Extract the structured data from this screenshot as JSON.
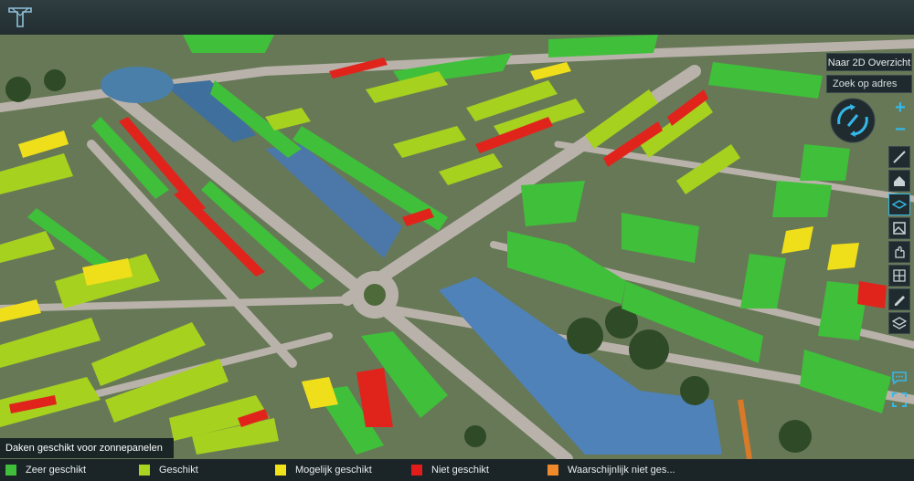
{
  "header": {
    "logo_icon": "tygron-logo-icon"
  },
  "map": {
    "icon": "3d-city-map",
    "colors": {
      "very_suitable": "#3fbf3a",
      "suitable": "#9fd321",
      "possibly": "#f0e020",
      "not": "#e02020",
      "unlikely": "#f08a20",
      "water": "#4a7fb0",
      "road": "#b8b0a8",
      "grass": "#6e8a4e"
    }
  },
  "controls": {
    "view_2d_label": "Naar 2D Overzicht",
    "search_placeholder": "Zoek op adres",
    "zoom_in": "+",
    "zoom_out": "−",
    "compass_icon": "compass-rotate-icon",
    "tools": [
      {
        "icon": "measure-icon",
        "active": false
      },
      {
        "icon": "home-icon",
        "active": false
      },
      {
        "icon": "layers-icon",
        "active": true
      },
      {
        "icon": "image-icon",
        "active": false
      },
      {
        "icon": "hand-icon",
        "active": false
      },
      {
        "icon": "grid-icon",
        "active": false
      },
      {
        "icon": "pen-icon",
        "active": false
      },
      {
        "icon": "stack-icon",
        "active": false
      }
    ],
    "chat_icon": "chat-icon",
    "fullscreen_icon": "fullscreen-icon"
  },
  "legend": {
    "title": "Daken geschikt voor zonnepanelen",
    "items": [
      {
        "label": "Zeer geschikt",
        "color": "#3fbf3a"
      },
      {
        "label": "Geschikt",
        "color": "#a9d41f"
      },
      {
        "label": "Mogelijk geschikt",
        "color": "#f2e21a"
      },
      {
        "label": "Niet geschikt",
        "color": "#e21b1b"
      },
      {
        "label": "Waarschijnlijk niet ges...",
        "color": "#f0892a"
      }
    ]
  }
}
